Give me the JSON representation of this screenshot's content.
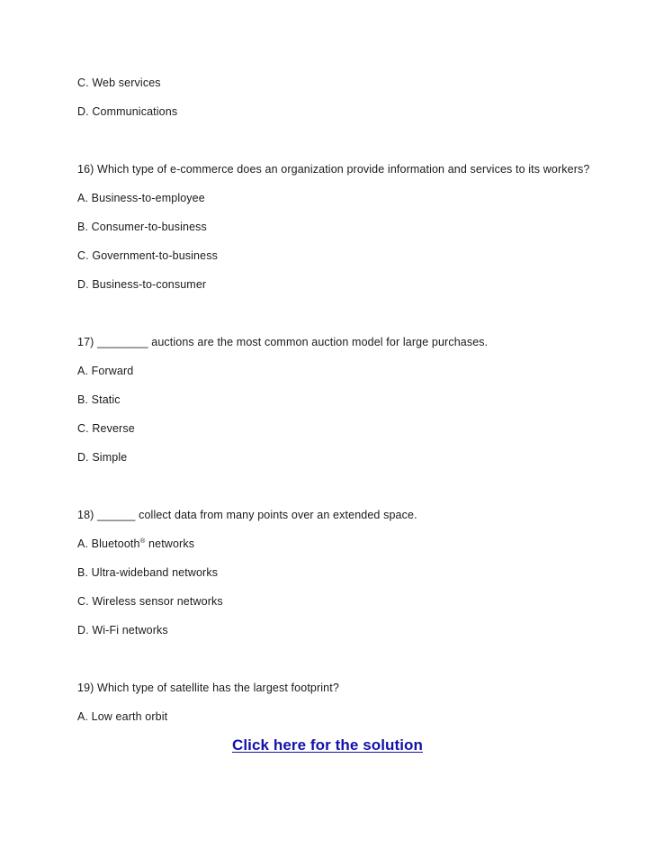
{
  "document": {
    "background_color": "#ffffff",
    "text_color": "#1a1a1a"
  },
  "carryover_options": [
    {
      "label": "C. Web services"
    },
    {
      "label": "D. Communications"
    }
  ],
  "questions": [
    {
      "number": "16)",
      "text": "16) Which type of e-commerce does an organization provide information and services to its workers?",
      "options": [
        {
          "label": "A. Business-to-employee"
        },
        {
          "label": "B. Consumer-to-business"
        },
        {
          "label": "C. Government-to-business"
        },
        {
          "label": "D. Business-to-consumer"
        }
      ]
    },
    {
      "number": "17)",
      "text": "17) ________ auctions are the most common auction model for large purchases.",
      "options": [
        {
          "label": "A. Forward"
        },
        {
          "label": "B. Static"
        },
        {
          "label": "C. Reverse"
        },
        {
          "label": "D. Simple"
        }
      ]
    },
    {
      "number": "18)",
      "text": "18) ______ collect data from many points over an extended space.",
      "options": [
        {
          "label": "A. Bluetooth"
        },
        {
          "label": "B. Ultra-wideband networks"
        },
        {
          "label": "C. Wireless sensor networks"
        },
        {
          "label": "D. Wi-Fi networks"
        }
      ],
      "option_a_parts": {
        "prefix": "A. Bluetooth",
        "superscript": "®",
        "suffix": " networks"
      }
    },
    {
      "number": "19)",
      "text": "19) Which type of satellite has the largest footprint?",
      "options": [
        {
          "label": "A. Low earth orbit"
        }
      ]
    }
  ],
  "solution_link": {
    "label": "Click here for the solution",
    "color": "#1212a8"
  }
}
